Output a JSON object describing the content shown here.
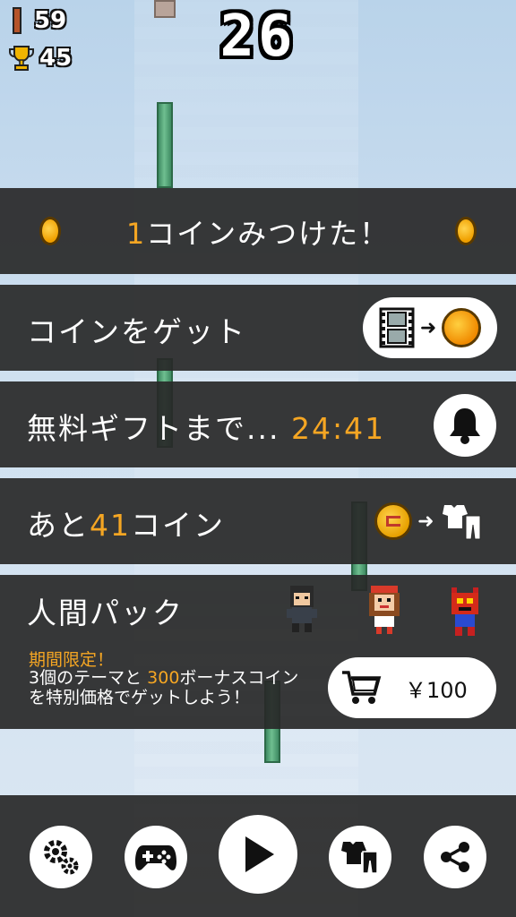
{
  "hud": {
    "bars": "59",
    "trophies": "45",
    "score": "26"
  },
  "coin_found": {
    "count": "1",
    "text": "コインみつけた！"
  },
  "get_coin": {
    "label": "コインをゲット"
  },
  "free_gift": {
    "label": "無料ギフトまで...",
    "timer": "24:41"
  },
  "coins_left": {
    "prefix": "あと",
    "count": "41",
    "suffix": "コイン"
  },
  "human_pack": {
    "title": "人間パック",
    "limited": "期間限定！",
    "line1_a": "3個のテーマと",
    "line1_bonus": "300",
    "line1_b": "ボーナスコイン",
    "line2": "を特別価格でゲットしよう！",
    "price": "￥100"
  },
  "colors": {
    "accent": "#f5a623",
    "panel": "#282828"
  },
  "icons": {
    "bottom": [
      "gears-icon",
      "gamepad-icon",
      "play-icon",
      "costume-icon",
      "share-icon"
    ]
  }
}
